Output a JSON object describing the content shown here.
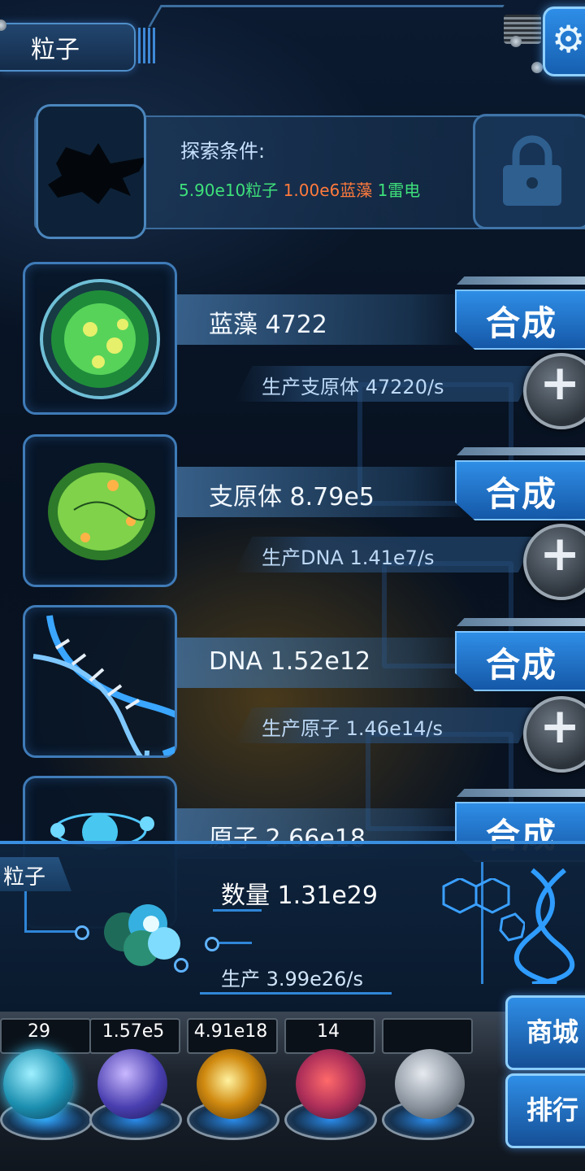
{
  "header": {
    "title": "粒子",
    "settings_icon": "gear-icon"
  },
  "explore": {
    "label": "探索条件:",
    "requirements": [
      {
        "text": "5.90e10粒子",
        "color": "#3ee07a"
      },
      {
        "text": "1.00e6蓝藻",
        "color": "#ff7a3c"
      },
      {
        "text": "1雷电",
        "color": "#3ee07a"
      }
    ],
    "lock_icon": "lock-icon",
    "creature_icon": "silhouette-icon"
  },
  "resources": [
    {
      "name": "蓝藻 4722",
      "production": "生产支原体 47220/s",
      "synth_label": "合成",
      "icon": "cyanobacteria-icon"
    },
    {
      "name": "支原体 8.79e5",
      "production": "生产DNA 1.41e7/s",
      "synth_label": "合成",
      "icon": "mycoplasma-icon"
    },
    {
      "name": "DNA 1.52e12",
      "production": "生产原子 1.46e14/s",
      "synth_label": "合成",
      "icon": "dna-icon"
    },
    {
      "name": "原子 2.66e18",
      "production": "",
      "synth_label": "合成",
      "icon": "atom-icon"
    }
  ],
  "panel": {
    "tab_label": "粒子",
    "quantity": "数量 1.31e29",
    "production": "生产 3.99e26/s"
  },
  "dock": {
    "counts": [
      "29",
      "1.57e5",
      "4.91e18",
      "14",
      ""
    ],
    "orbs": [
      "particle-orb-icon",
      "lightning-orb-icon",
      "galaxy-orb-icon",
      "brain-orb-icon",
      "locked-orb-icon"
    ],
    "shop_label": "商城",
    "rank_label": "排行"
  },
  "colors": {
    "accent": "#2f8ee6",
    "requirement_met": "#3ee07a",
    "requirement_unmet": "#ff7a3c"
  }
}
